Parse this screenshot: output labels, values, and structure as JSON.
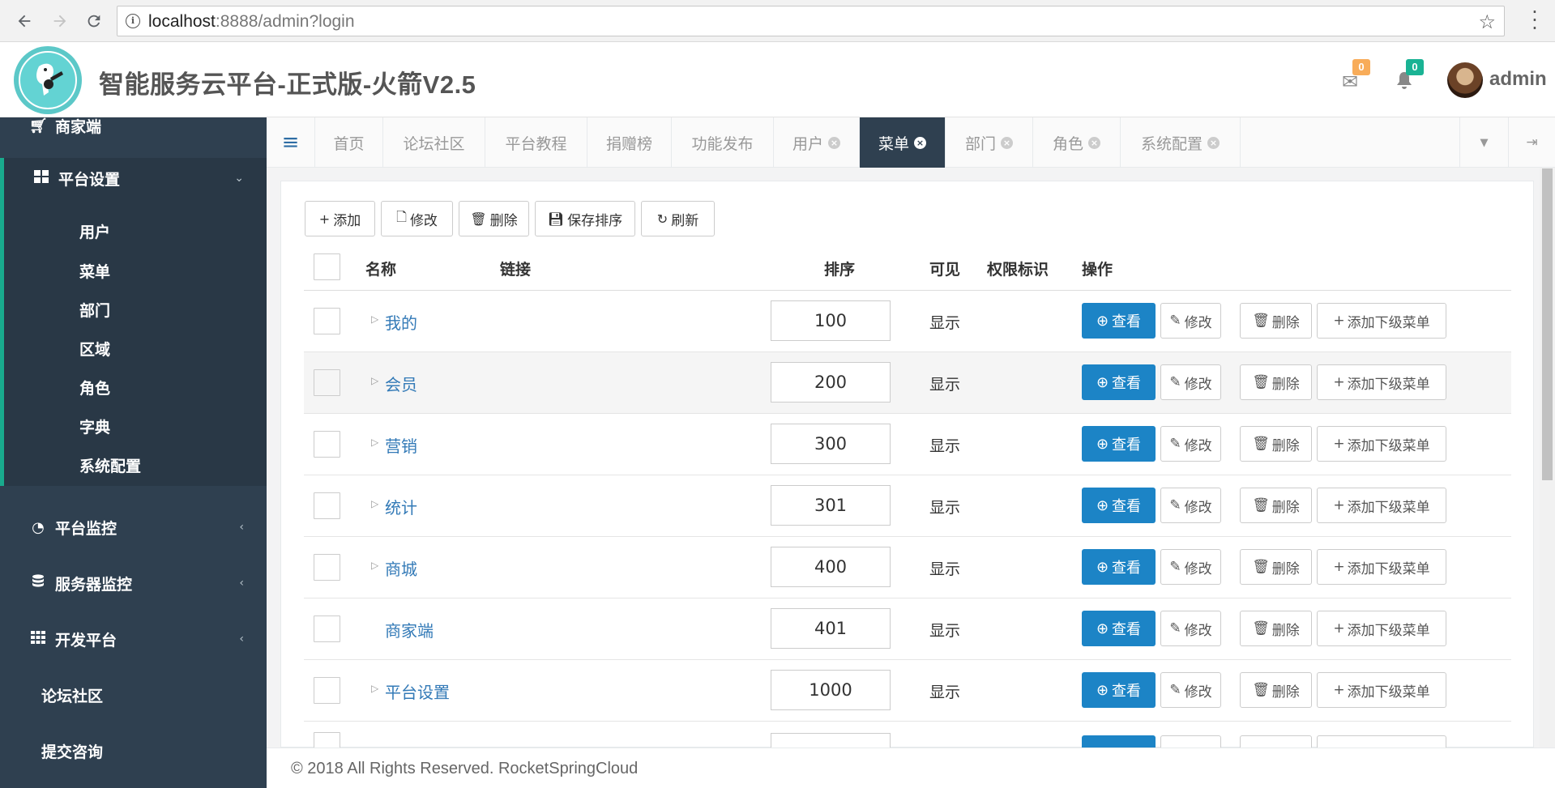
{
  "browser": {
    "url_host": "localhost",
    "url_rest": ":8888/admin?login"
  },
  "header": {
    "title": "智能服务云平台-正式版-火箭V2.5",
    "mail_count": "0",
    "notify_count": "0",
    "user": "admin",
    "colors": {
      "mail_badge": "#f8ac59",
      "notify_badge": "#1ab394"
    }
  },
  "sidebar": {
    "top_item": "商家端",
    "group_platform": "平台设置",
    "sub_items": [
      "用户",
      "菜单",
      "部门",
      "区域",
      "角色",
      "字典",
      "系统配置"
    ],
    "monitor": "平台监控",
    "server": "服务器监控",
    "dev": "开发平台",
    "forum": "论坛社区",
    "consult": "提交咨询"
  },
  "tabs": [
    {
      "label": "首页"
    },
    {
      "label": "论坛社区"
    },
    {
      "label": "平台教程"
    },
    {
      "label": "捐赠榜"
    },
    {
      "label": "功能发布"
    },
    {
      "label": "用户"
    },
    {
      "label": "菜单"
    },
    {
      "label": "部门"
    },
    {
      "label": "角色"
    },
    {
      "label": "系统配置"
    }
  ],
  "toolbar": {
    "add": "添加",
    "edit": "修改",
    "delete": "删除",
    "save_order": "保存排序",
    "refresh": "刷新"
  },
  "table": {
    "headers": {
      "name": "名称",
      "link": "链接",
      "order": "排序",
      "visible": "可见",
      "perm": "权限标识",
      "ops": "操作"
    },
    "rows": [
      {
        "name": "我的",
        "order": "100",
        "visible": "显示"
      },
      {
        "name": "会员",
        "order": "200",
        "visible": "显示"
      },
      {
        "name": "营销",
        "order": "300",
        "visible": "显示"
      },
      {
        "name": "统计",
        "order": "301",
        "visible": "显示"
      },
      {
        "name": "商城",
        "order": "400",
        "visible": "显示"
      },
      {
        "name": "商家端",
        "order": "401",
        "visible": "显示"
      },
      {
        "name": "平台设置",
        "order": "1000",
        "visible": "显示"
      }
    ],
    "actions": {
      "view": "查看",
      "edit": "修改",
      "delete": "删除",
      "add_child": "添加下级菜单"
    }
  },
  "footer": {
    "text": "© 2018 All Rights Reserved. RocketSpringCloud"
  }
}
